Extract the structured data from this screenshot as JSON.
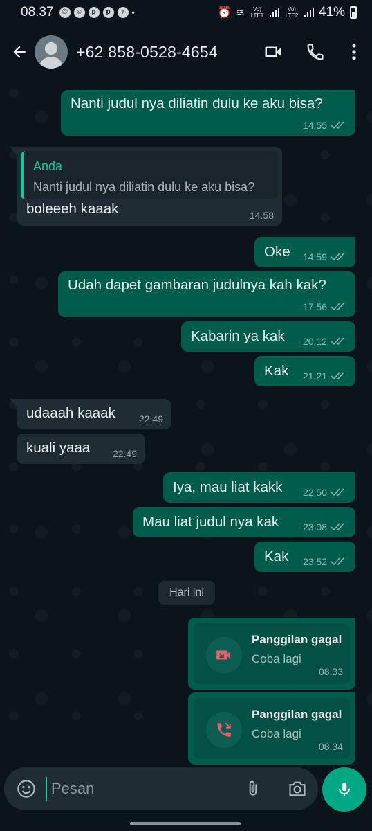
{
  "status_bar": {
    "time": "08.37",
    "battery": "41%",
    "sim1": "Vo) LTE1",
    "sim2": "Vo) LTE2"
  },
  "header": {
    "contact": "+62 858-0528-4654"
  },
  "messages": [
    {
      "text": "Nanti judul nya diliatin dulu ke aku bisa?",
      "time": "14.55"
    },
    {
      "quote_name": "Anda",
      "quote_text": "Nanti judul nya diliatin dulu ke aku bisa?",
      "text": "boleeeh kaaak",
      "time": "14.58"
    },
    {
      "text": "Oke",
      "time": "14.59"
    },
    {
      "text": "Udah dapet gambaran judulnya kah kak?",
      "time": "17.56"
    },
    {
      "text": "Kabarin ya kak",
      "time": "20.12"
    },
    {
      "text": "Kak",
      "time": "21.21"
    },
    {
      "text": "udaaah kaaak",
      "time": "22.49"
    },
    {
      "text": "kuali yaaa",
      "time": "22.49"
    },
    {
      "text": "Iya, mau liat kakk",
      "time": "22.50"
    },
    {
      "text": "Mau liat judul nya kak",
      "time": "23.08"
    },
    {
      "text": "Kak",
      "time": "23.52"
    }
  ],
  "date_divider": "Hari ini",
  "calls": [
    {
      "title": "Panggilan gagal",
      "subtitle": "Coba lagi",
      "time": "08.33",
      "icon": "missed-video-call-icon"
    },
    {
      "title": "Panggilan gagal",
      "subtitle": "Coba lagi",
      "time": "08.34",
      "icon": "missed-voice-call-icon"
    }
  ],
  "input": {
    "placeholder": "Pesan"
  },
  "colors": {
    "outgoing": "#005c4b",
    "incoming": "#202c33",
    "accent": "#00a884",
    "missed_call": "#f15c6d"
  }
}
